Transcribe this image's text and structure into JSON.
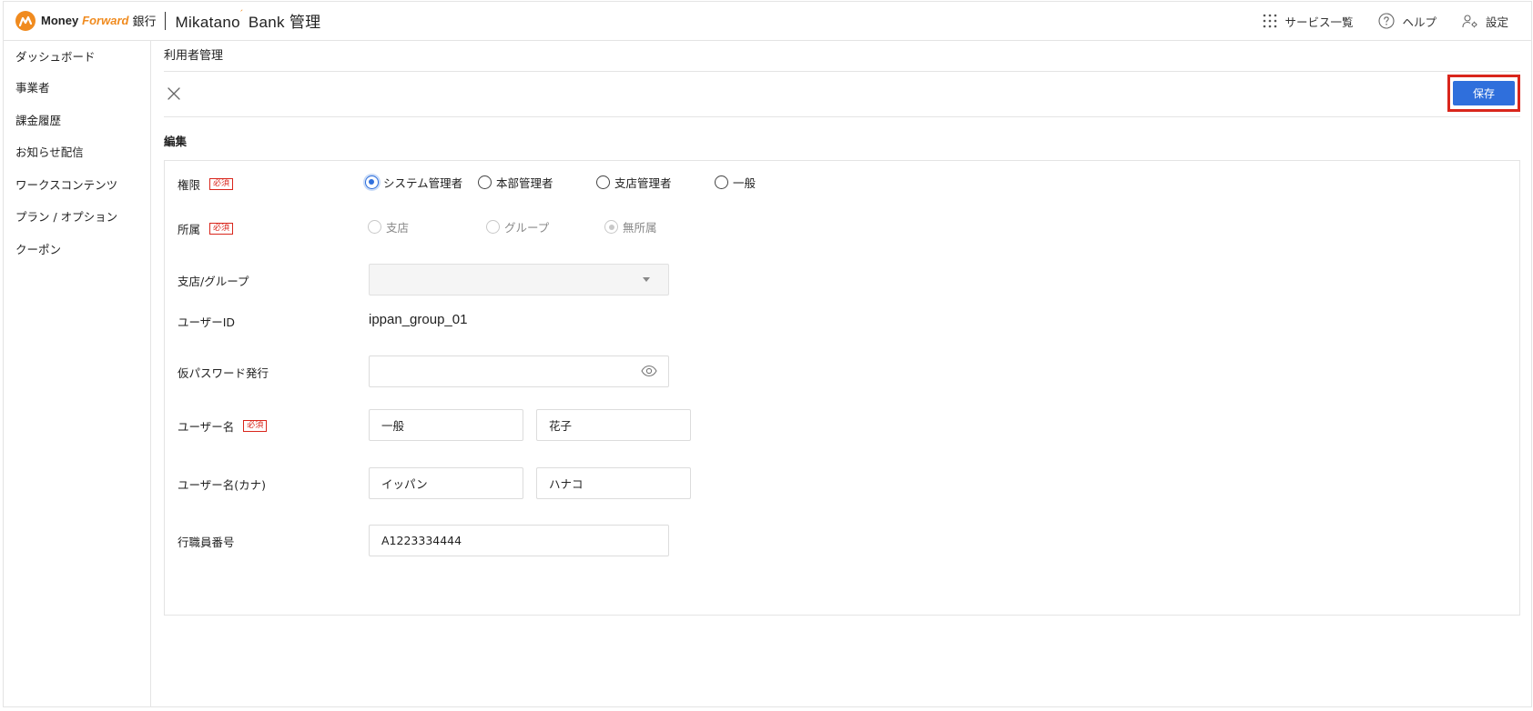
{
  "header": {
    "brand_money": "Money",
    "brand_forward": "Forward",
    "brand_bank": "銀行",
    "app_name": "Mikatano",
    "app_bank": "Bank",
    "app_suffix": "管理",
    "nav": {
      "services_label": "サービス一覧",
      "help_label": "ヘルプ",
      "settings_label": "設定"
    }
  },
  "sidebar": {
    "items": [
      {
        "label": "ダッシュボード"
      },
      {
        "label": "事業者"
      },
      {
        "label": "課金履歴"
      },
      {
        "label": "お知らせ配信"
      },
      {
        "label": "ワークスコンテンツ"
      },
      {
        "label": "プラン / オプション"
      },
      {
        "label": "クーポン"
      }
    ]
  },
  "main": {
    "page_title": "利用者管理",
    "save_label": "保存",
    "section_title": "編集",
    "required_label": "必須",
    "form": {
      "role": {
        "label": "権限",
        "options": [
          "システム管理者",
          "本部管理者",
          "支店管理者",
          "一般"
        ],
        "selected": "システム管理者"
      },
      "affiliation": {
        "label": "所属",
        "options": [
          "支店",
          "グループ",
          "無所属"
        ],
        "selected": "無所属"
      },
      "branch_group": {
        "label": "支店/グループ",
        "value": ""
      },
      "user_id": {
        "label": "ユーザーID",
        "value": "ippan_group_01"
      },
      "temp_password": {
        "label": "仮パスワード発行",
        "value": ""
      },
      "user_name": {
        "label": "ユーザー名",
        "last": "一般",
        "first": "花子"
      },
      "user_name_kana": {
        "label": "ユーザー名(カナ)",
        "last": "イッパン",
        "first": "ハナコ"
      },
      "staff_number": {
        "label": "行職員番号",
        "value": "A1223334444"
      }
    }
  },
  "colors": {
    "brand_orange": "#f08b1f",
    "primary_blue": "#2f6fdc",
    "required_red": "#d9261c",
    "highlight_red": "#d9261c"
  }
}
